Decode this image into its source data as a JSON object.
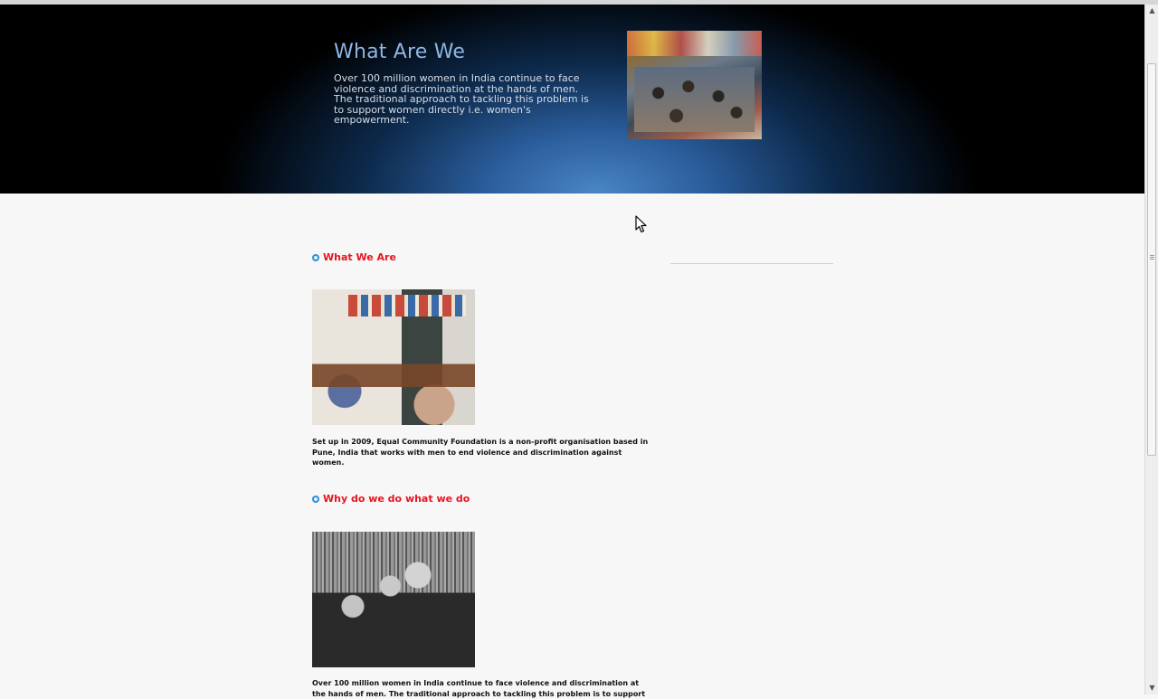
{
  "hero": {
    "title": "What Are We",
    "text": "Over 100 million women in India continue to face violence and discrimination at the hands of men. The traditional approach to tackling this problem is to support women directly i.e. women's empowerment."
  },
  "sections": [
    {
      "title": "What We Are",
      "text": "Set up in 2009, Equal Community Foundation is a non-profit organisation based in Pune, India that works with men to end violence and discrimination against women."
    },
    {
      "title": "Why do we do what we do",
      "text": "Over 100 million women in India continue to face violence and discrimination at the hands of men. The traditional approach to tackling this problem is to support"
    }
  ],
  "scrollbar": {
    "up_arrow": "▲",
    "down_arrow": "▼"
  },
  "colors": {
    "accent_red": "#e8141e",
    "hero_title": "#8fb6e3",
    "bullet_blue": "#2f8fd8"
  }
}
